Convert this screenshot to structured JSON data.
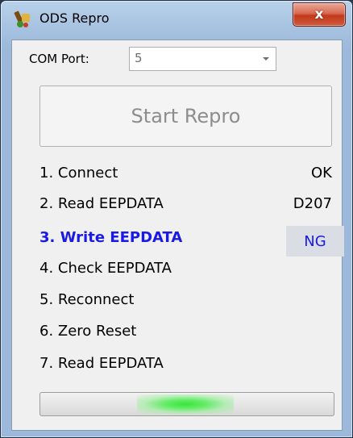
{
  "window": {
    "title": "ODS Repro",
    "close_label": "x"
  },
  "com_port": {
    "label": "COM Port:",
    "value": "5"
  },
  "start_button": {
    "label": "Start Repro"
  },
  "steps": [
    {
      "label": "1. Connect",
      "result": "OK"
    },
    {
      "label": "2. Read EEPDATA",
      "result": "D207"
    },
    {
      "label": "3. Write EEPDATA",
      "result": "NG"
    },
    {
      "label": "4. Check EEPDATA",
      "result": ""
    },
    {
      "label": "5. Reconnect",
      "result": ""
    },
    {
      "label": "6. Zero Reset",
      "result": ""
    },
    {
      "label": "7. Read EEPDATA",
      "result": ""
    }
  ],
  "colors": {
    "active_step": "#1a1ae6",
    "progress_glow": "#37e63a",
    "close_button": "#c2391b"
  },
  "icons": {
    "app": "app-logo-icon",
    "combo": "chevron-down-icon"
  },
  "progress": {
    "state": "marquee"
  }
}
